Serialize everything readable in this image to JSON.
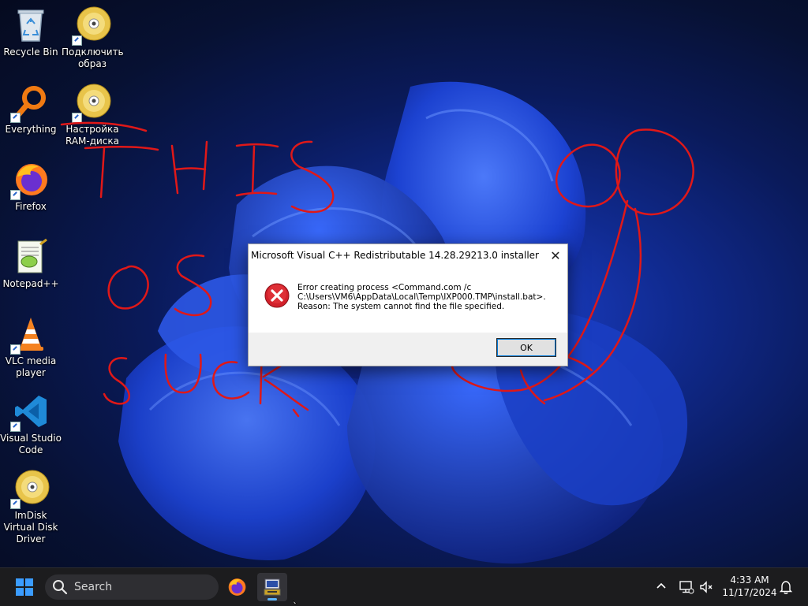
{
  "desktop": {
    "icons": [
      {
        "label": "Recycle Bin",
        "icon": "recycle-bin-icon"
      },
      {
        "label": "Подключить образ",
        "icon": "disc-image-icon"
      },
      {
        "label": "Everything",
        "icon": "magnifier-search-icon"
      },
      {
        "label": "Настройка RAM-диска",
        "icon": "disc-image-icon"
      },
      {
        "label": "Firefox",
        "icon": "firefox-icon"
      },
      {
        "label": "Notepad++",
        "icon": "notepad-plus-plus-icon"
      },
      {
        "label": "VLC media player",
        "icon": "vlc-cone-icon"
      },
      {
        "label": "Visual Studio Code",
        "icon": "vscode-icon"
      },
      {
        "label": "ImDisk Virtual Disk Driver",
        "icon": "disc-image-icon"
      }
    ]
  },
  "dialog": {
    "title": "Microsoft Visual C++ Redistributable 14.28.29213.0 installer",
    "close_label": "✕",
    "message_line1": "Error creating process <Command.com /c",
    "message_line2": "C:\\Users\\VM6\\AppData\\Local\\Temp\\IXP000.TMP\\install.bat>.",
    "message_line3": "Reason: The system cannot find the file specified.",
    "ok_label": "OK",
    "icon": "error-x-icon"
  },
  "taskbar": {
    "search_placeholder": "Search",
    "apps": [
      "firefox-icon",
      "installer-app-icon"
    ],
    "clock_time": "4:33 AM",
    "clock_date": "11/17/2024",
    "accent_color": "#3b9cff"
  },
  "colors": {
    "scribble": "#e01818",
    "error_red": "#d2202a"
  }
}
